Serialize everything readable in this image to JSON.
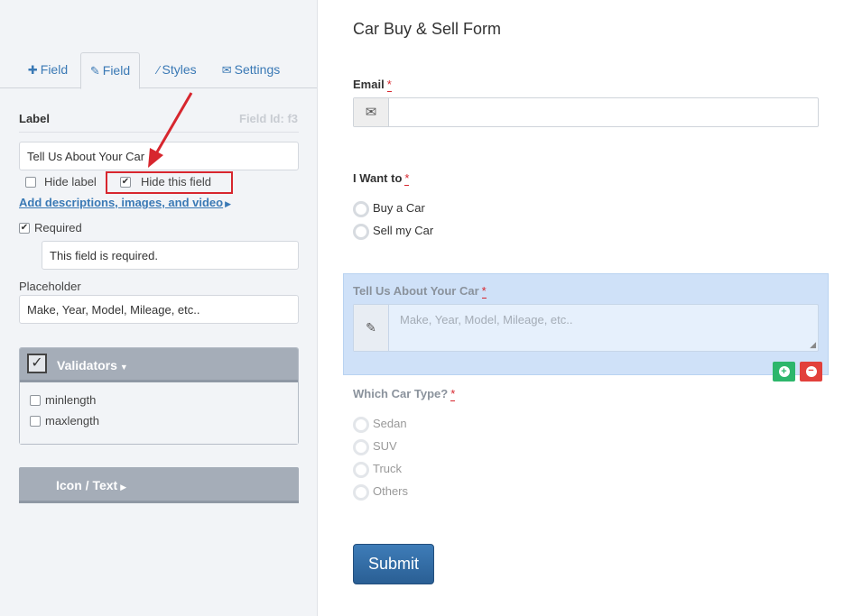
{
  "tabs": [
    {
      "label": "Field",
      "icon": "plus-icon"
    },
    {
      "label": "Field",
      "icon": "edit-icon"
    },
    {
      "label": "Styles",
      "icon": "wand-icon"
    },
    {
      "label": "Settings",
      "icon": "envelope-icon"
    }
  ],
  "field_editor": {
    "label_heading": "Label",
    "field_id": "Field Id: f3",
    "label_value": "Tell Us About Your Car",
    "hide_label": {
      "label": "Hide label",
      "checked": false
    },
    "hide_field": {
      "label": "Hide this field",
      "checked": true
    },
    "add_descriptions_link": "Add descriptions, images, and video",
    "required": {
      "label": "Required",
      "checked": true
    },
    "required_message": "This field is required.",
    "placeholder_heading": "Placeholder",
    "placeholder_value": "Make, Year, Model, Mileage, etc.."
  },
  "validators": {
    "title": "Validators",
    "items": [
      {
        "label": "minlength",
        "checked": false
      },
      {
        "label": "maxlength",
        "checked": false
      }
    ]
  },
  "icon_text_panel": {
    "title": "Icon / Text"
  },
  "form": {
    "title": "Car Buy & Sell Form",
    "email": {
      "label": "Email",
      "required_mark": "*"
    },
    "i_want_to": {
      "label": "I Want to",
      "required_mark": "*",
      "options": [
        "Buy a Car",
        "Sell my Car"
      ]
    },
    "tell_us": {
      "label": "Tell Us About Your Car",
      "required_mark": "*",
      "placeholder": "Make, Year, Model, Mileage, etc.."
    },
    "car_type": {
      "label": "Which Car Type?",
      "required_mark": "*",
      "options": [
        "Sedan",
        "SUV",
        "Truck",
        "Others"
      ]
    },
    "submit_label": "Submit"
  },
  "colors": {
    "accent": "#3a79b5",
    "highlight_red": "#d7262e",
    "add_green": "#2db66b",
    "remove_red": "#e2403b",
    "hidden_field_bg": "#cfe1f8"
  }
}
